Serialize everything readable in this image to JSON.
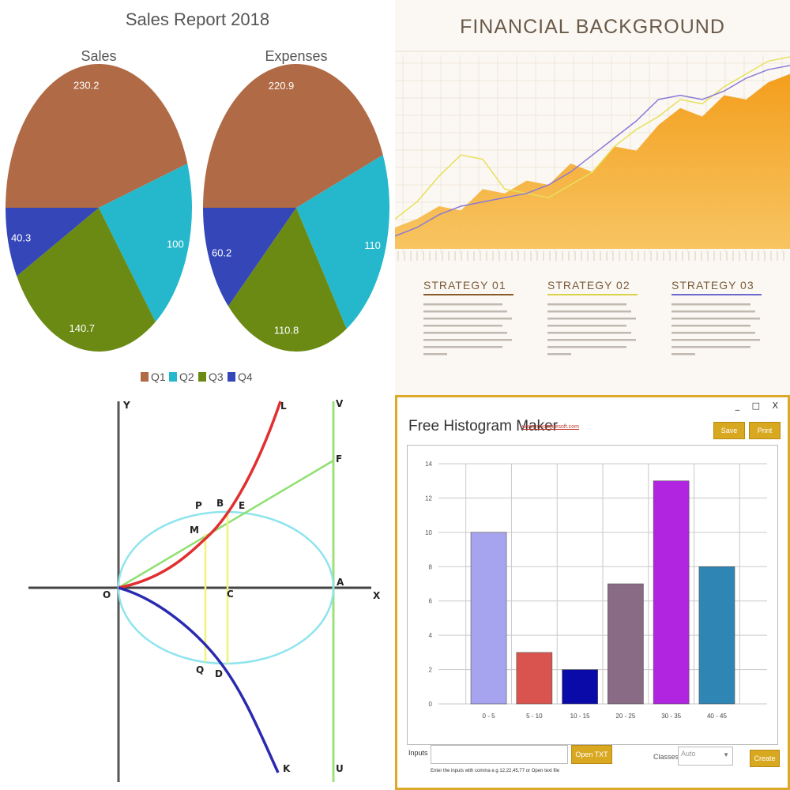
{
  "pie_panel": {
    "legend": [
      {
        "label": "Q1",
        "color": "#b06a45"
      },
      {
        "label": "Q2",
        "color": "#25b8cc"
      },
      {
        "label": "Q3",
        "color": "#6b8a14"
      },
      {
        "label": "Q4",
        "color": "#3446b8"
      }
    ]
  },
  "finance_panel": {
    "title": "FINANCIAL BACKGROUND",
    "strategies": [
      {
        "label": "STRATEGY 01",
        "color": "#8a5a2a"
      },
      {
        "label": "STRATEGY 02",
        "color": "#d9d24a"
      },
      {
        "label": "STRATEGY 03",
        "color": "#6a6ad0"
      }
    ]
  },
  "geometry_panel": {
    "labels": [
      "Y",
      "L",
      "V",
      "F",
      "P",
      "B",
      "E",
      "M",
      "O",
      "C",
      "A",
      "X",
      "Q",
      "D",
      "K",
      "U"
    ]
  },
  "histogram_app": {
    "window_controls": "_ □ X",
    "title": "Free Histogram Maker",
    "link": "www.mediafiresoft.com",
    "save_label": "Save",
    "print_label": "Print",
    "inputs_label": "Inputs",
    "inputs_value": "",
    "open_txt_label": "Open TXT file",
    "hint": "Enter the inputs with comma e.g 12,22,45,77 or Open text file",
    "classes_label": "Classes",
    "classes_value": "Auto",
    "create_label": "Create"
  },
  "chart_data": [
    {
      "type": "pie",
      "title": "Sales Report 2018",
      "subtitle": "Sales",
      "categories": [
        "Q1",
        "Q2",
        "Q3",
        "Q4"
      ],
      "values": [
        230.2,
        100,
        140.7,
        40.3
      ],
      "colors": [
        "#b06a45",
        "#25b8cc",
        "#6b8a14",
        "#3446b8"
      ],
      "legend": "bottom"
    },
    {
      "type": "pie",
      "title": "Sales Report 2018",
      "subtitle": "Expenses",
      "categories": [
        "Q1",
        "Q2",
        "Q3",
        "Q4"
      ],
      "values": [
        220.9,
        110,
        110.8,
        60.2
      ],
      "colors": [
        "#b06a45",
        "#25b8cc",
        "#6b8a14",
        "#3446b8"
      ],
      "legend": "bottom"
    },
    {
      "type": "area",
      "title": "FINANCIAL BACKGROUND",
      "series": [
        {
          "name": "area",
          "values": [
            10,
            14,
            20,
            18,
            28,
            26,
            32,
            30,
            40,
            36,
            48,
            46,
            58,
            66,
            62,
            72,
            70,
            78,
            82
          ]
        },
        {
          "name": "line-yellow",
          "values": [
            14,
            22,
            34,
            44,
            42,
            28,
            26,
            24,
            30,
            36,
            48,
            56,
            62,
            70,
            68,
            76,
            82,
            88,
            90
          ]
        },
        {
          "name": "line-purple",
          "values": [
            6,
            10,
            16,
            20,
            22,
            24,
            26,
            30,
            36,
            44,
            52,
            60,
            70,
            72,
            70,
            74,
            80,
            84,
            86
          ]
        }
      ],
      "grid": true
    },
    {
      "type": "bar",
      "categories": [
        "0 - 5",
        "5 - 10",
        "10 - 15",
        "20 - 25",
        "30 - 35",
        "40 - 45"
      ],
      "values": [
        10,
        3,
        2,
        7,
        13,
        8
      ],
      "colors": [
        "#a7a4ef",
        "#d9544f",
        "#0a0aa8",
        "#8a6b85",
        "#b125e0",
        "#2f85b3"
      ],
      "ylim": [
        0,
        14
      ],
      "yticks": [
        "0",
        "2",
        "4",
        "6",
        "8",
        "10",
        "12",
        "14"
      ],
      "grid": true
    }
  ]
}
